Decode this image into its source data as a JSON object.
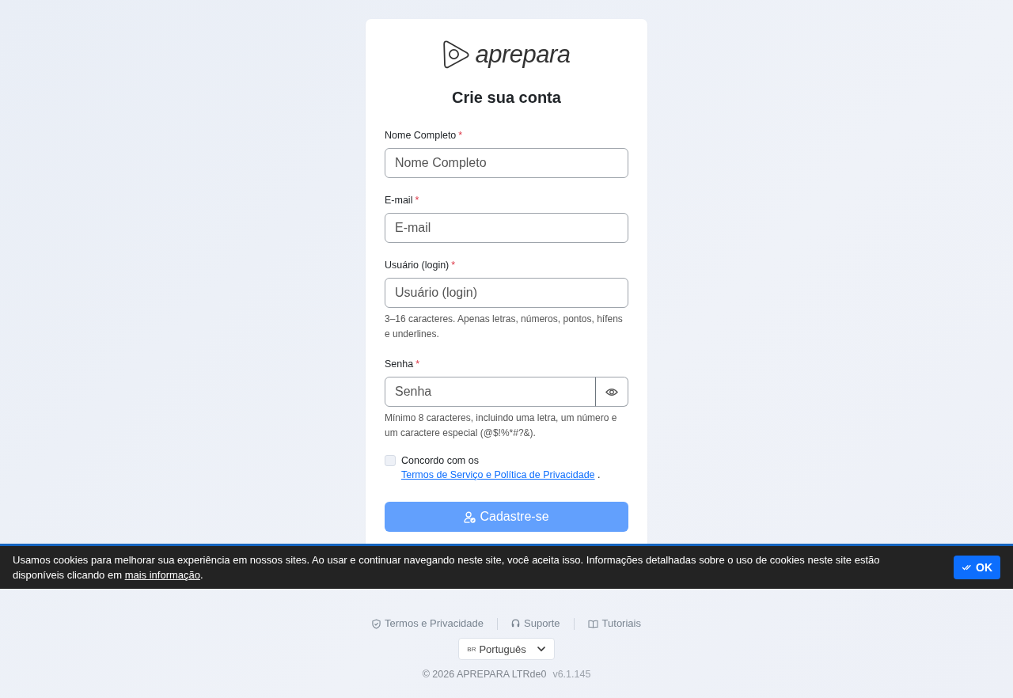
{
  "logo": {
    "text": "aprepara"
  },
  "title": "Crie sua conta",
  "fields": [
    {
      "kind": "text",
      "label": "Nome Completo",
      "required_mark": "*",
      "placeholder": "Nome Completo"
    },
    {
      "kind": "text",
      "label": "E-mail",
      "required_mark": "*",
      "placeholder": "E-mail"
    },
    {
      "kind": "text",
      "label": "Usuário (login)",
      "required_mark": "*",
      "placeholder": "Usuário (login)",
      "hint": "3–16 caracteres. Apenas letras, números, pontos, hífens e underlines."
    },
    {
      "kind": "password",
      "label": "Senha",
      "required_mark": "*",
      "placeholder": "Senha",
      "hint": "Mínimo 8 caracteres, incluindo uma letra, um número e um caractere especial (@$!%*#?&)."
    }
  ],
  "terms": {
    "checked": false,
    "prefix": "Concordo com os",
    "link": "Termos de Serviço e Política de Privacidade",
    "suffix": "."
  },
  "submit": {
    "label": "Cadastre-se",
    "disabled": true
  },
  "footer": {
    "links": [
      {
        "kind": "privacy",
        "label": "Termos e Privacidade"
      },
      {
        "kind": "support",
        "label": "Suporte"
      },
      {
        "kind": "tutorials",
        "label": "Tutoriais"
      }
    ],
    "language": {
      "flag": "BR",
      "label": "Português"
    },
    "copyright": "© 2026 APREPARA LTRde0",
    "version": "v6.1.145"
  },
  "cookie_banner": {
    "message": "Usamos cookies para melhorar sua experiência em nossos sites. Ao usar e continuar navegando neste site, você aceita isso. Informações detalhadas sobre o uso de cookies neste site estão disponíveis clicando em",
    "link": "mais informação",
    "suffix": ".",
    "button": "OK"
  }
}
